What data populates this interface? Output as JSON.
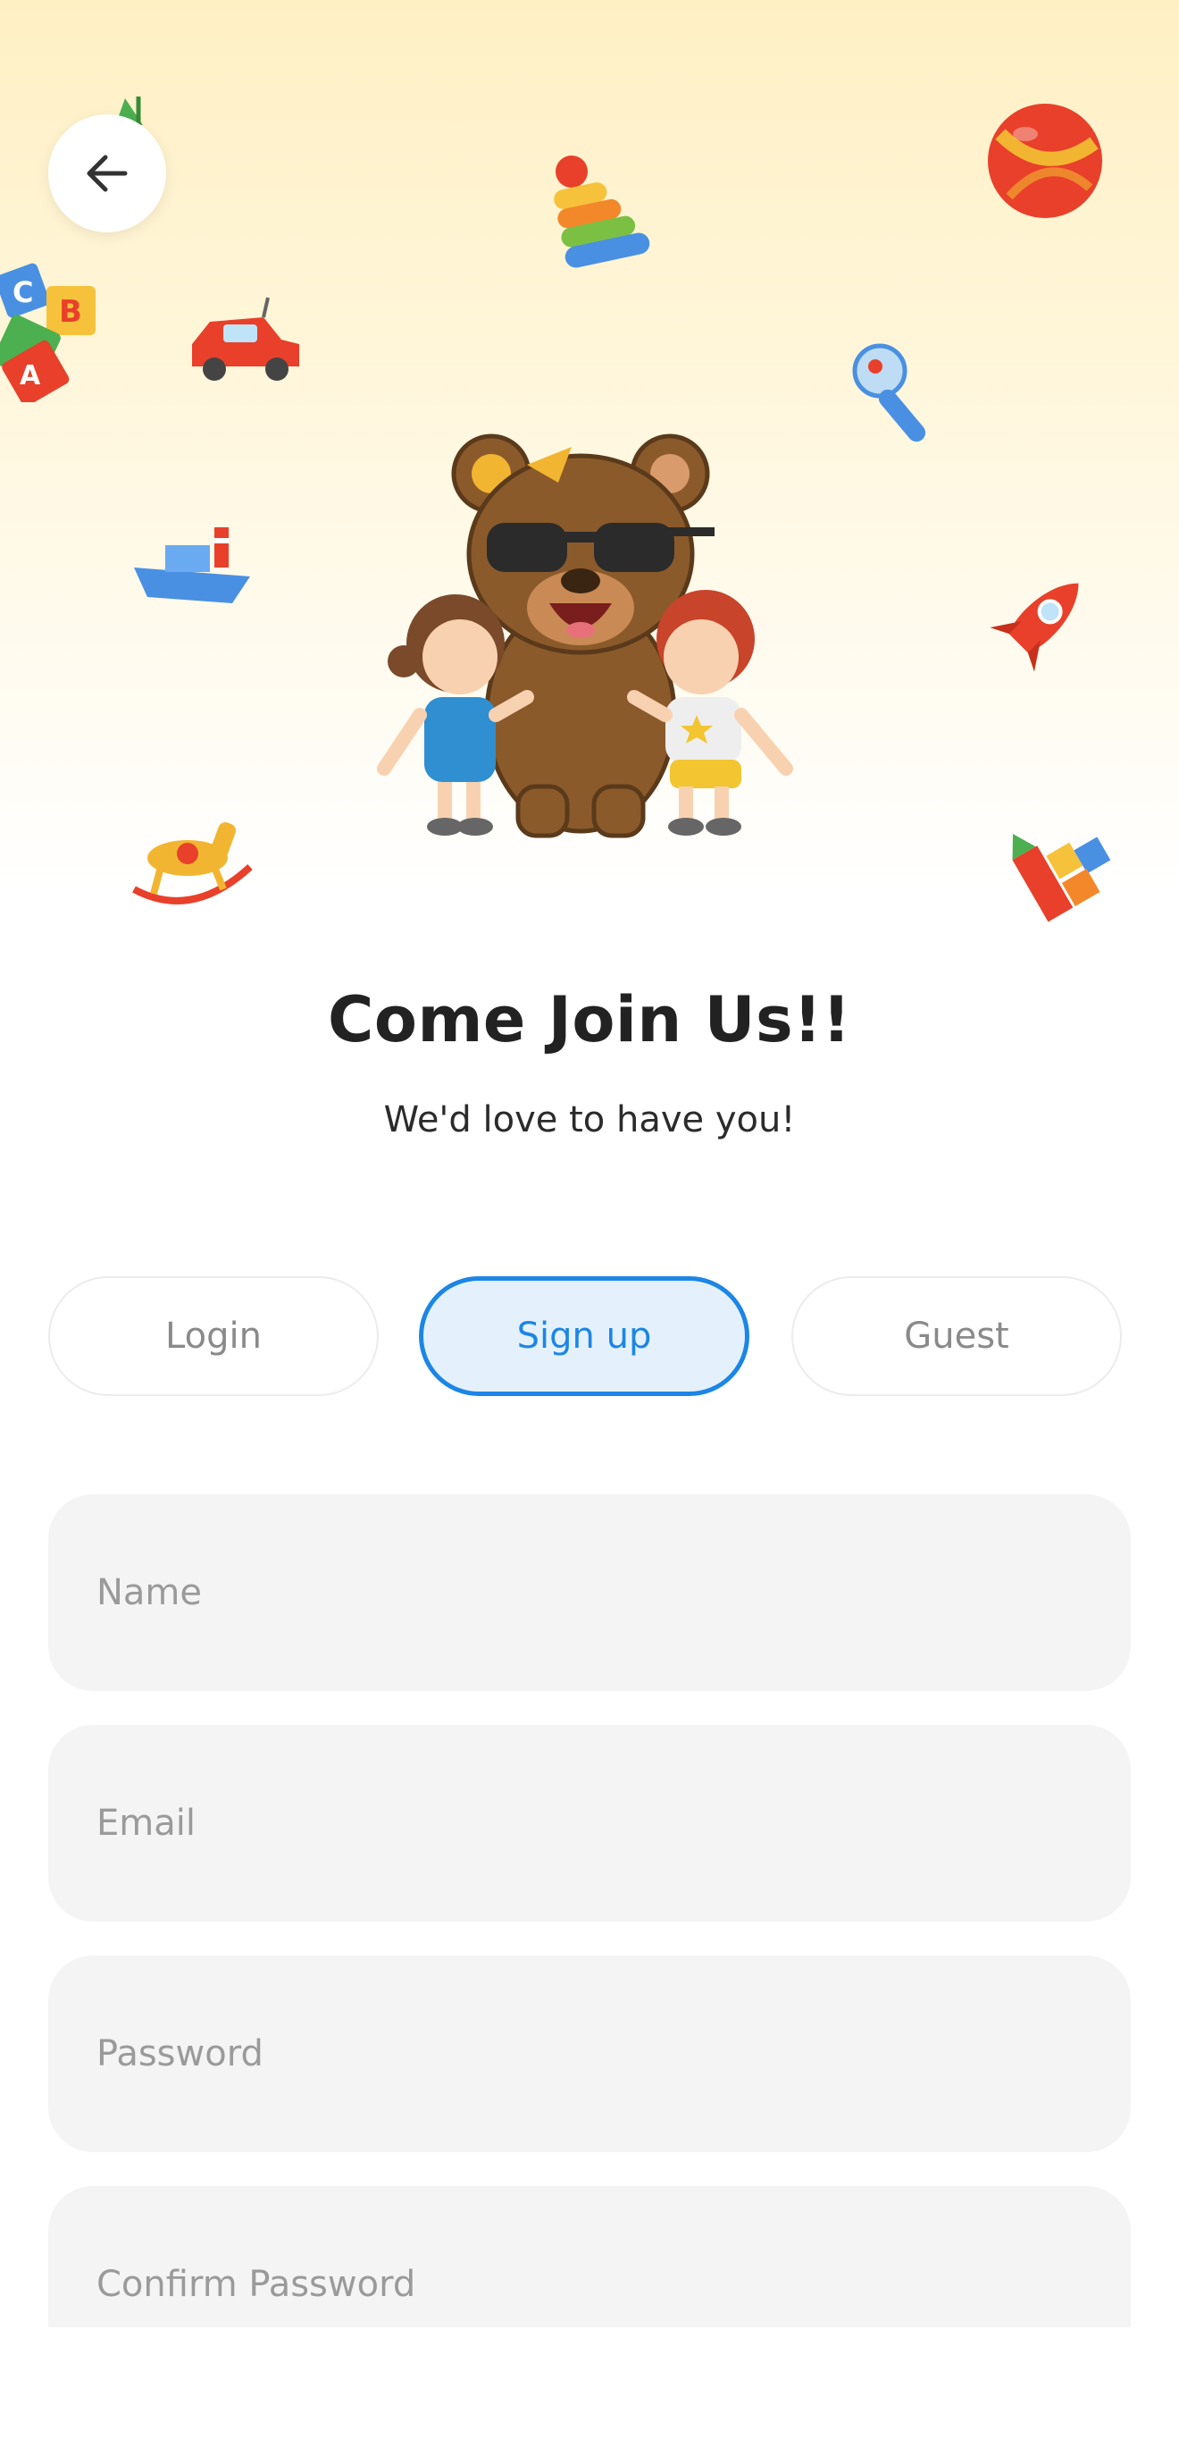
{
  "header": {
    "back_icon": "arrow-left-icon"
  },
  "hero": {
    "illustration": "bear-with-kids-illustration",
    "toys": [
      "ball-icon",
      "stacking-rings-icon",
      "toy-car-icon",
      "alphabet-blocks-icon",
      "rattle-icon",
      "toy-boat-icon",
      "rocket-icon",
      "rocking-horse-icon",
      "toy-tower-icon"
    ]
  },
  "title": "Come Join Us!!",
  "subtitle": "We'd love to have you!",
  "tabs": [
    {
      "label": "Login",
      "active": false
    },
    {
      "label": "Sign up",
      "active": true
    },
    {
      "label": "Guest",
      "active": false
    }
  ],
  "form": {
    "name_placeholder": "Name",
    "email_placeholder": "Email",
    "password_placeholder": "Password",
    "confirm_password_placeholder": "Confirm Password"
  },
  "colors": {
    "accent": "#1c86e6",
    "accent_bg": "#e4f1fd",
    "field_bg": "#f4f4f4",
    "hero_bg": "#fff0c4"
  }
}
